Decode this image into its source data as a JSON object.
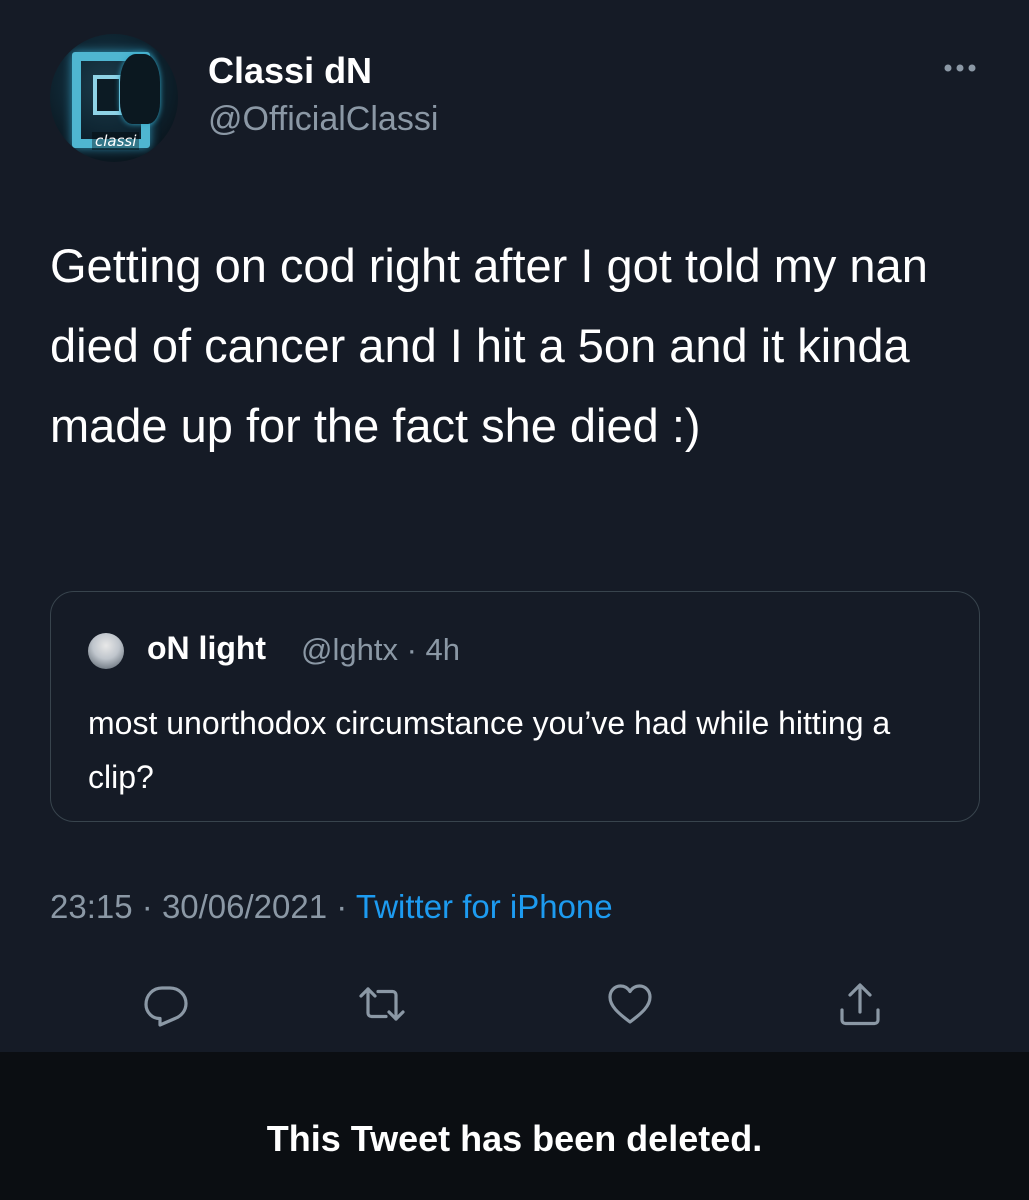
{
  "author": {
    "display_name": "Classi dN",
    "handle": "@OfficialClassi",
    "avatar_tag": "classi"
  },
  "tweet": {
    "text": "Getting on cod right after I got told my nan died of cancer and I hit a 5on and it kinda made up for the fact she died :)"
  },
  "quoted": {
    "name": "oN light",
    "handle": "@lghtx",
    "separator": "·",
    "time": "4h",
    "text": "most unorthodox circumstance you’ve had while hitting a clip?"
  },
  "meta": {
    "time": "23:15",
    "date": "30/06/2021",
    "separator": "·",
    "source": "Twitter for iPhone"
  },
  "actions": {
    "reply": "reply-icon",
    "retweet": "retweet-icon",
    "like": "heart-icon",
    "share": "share-icon"
  },
  "banner": {
    "text": "This Tweet has been deleted."
  },
  "colors": {
    "background": "#151b26",
    "secondary_text": "#8b98a5",
    "link": "#1d9bf0",
    "border": "#38444d",
    "banner_bg": "#0b0e12"
  }
}
